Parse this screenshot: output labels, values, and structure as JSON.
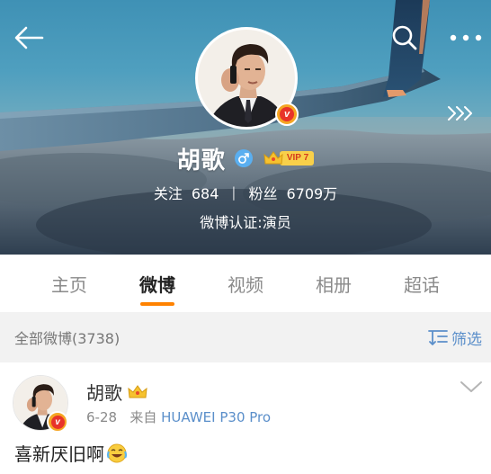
{
  "header": {
    "back_icon": "arrow-left-icon",
    "search_icon": "search-icon",
    "more_icon": "more-dots-icon",
    "expand_icon": "chevrons-right-icon"
  },
  "profile": {
    "name": "胡歌",
    "gender_icon": "male-icon",
    "vip_label": "VIP 7",
    "follow_label": "关注",
    "follow_count": "684",
    "fans_label": "粉丝",
    "fans_count": "6709万",
    "separator": "|",
    "verification": "微博认证:演员"
  },
  "tabs": [
    {
      "label": "主页",
      "active": false
    },
    {
      "label": "微博",
      "active": true
    },
    {
      "label": "视频",
      "active": false
    },
    {
      "label": "相册",
      "active": false
    },
    {
      "label": "超话",
      "active": false
    }
  ],
  "feed": {
    "title": "全部微博(3738)",
    "filter_label": "筛选"
  },
  "post": {
    "author": "胡歌",
    "date": "6-28",
    "source_prefix": "来自",
    "device": "HUAWEI P30 Pro",
    "text": "喜新厌旧啊",
    "emoji": "laugh-cry-emoji"
  },
  "colors": {
    "accent": "#ff8200",
    "link": "#5b8fca",
    "verified_badge": "#f5a623",
    "gender": "#5aaff0"
  }
}
